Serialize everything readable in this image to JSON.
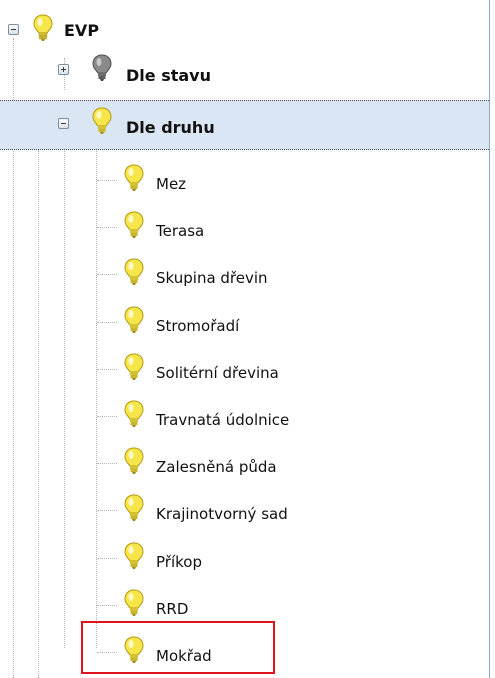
{
  "tree": {
    "root": {
      "label": "EVP",
      "expanded": true,
      "bulb": "yellow-bulb-icon"
    },
    "nodes": [
      {
        "label": "Dle stavu",
        "expanded": false,
        "bulb": "gray-bulb-icon"
      },
      {
        "label": "Dle druhu",
        "expanded": true,
        "selected": true,
        "bulb": "yellow-bulb-icon"
      }
    ],
    "leaves": [
      {
        "label": "Mez"
      },
      {
        "label": "Terasa"
      },
      {
        "label": "Skupina dřevin"
      },
      {
        "label": "Stromořadí"
      },
      {
        "label": "Solitérní dřevina"
      },
      {
        "label": "Travnatá údolnice"
      },
      {
        "label": "Zalesněná půda"
      },
      {
        "label": "Krajinotvorný sad"
      },
      {
        "label": "Příkop"
      },
      {
        "label": "RRD"
      },
      {
        "label": "Mokřad"
      }
    ]
  },
  "colors": {
    "selected_bg": "#dbe6f4",
    "bulb_yellow": "#f7e64a",
    "bulb_gray": "#8a8a8a",
    "highlight_border": "#e0141e"
  }
}
